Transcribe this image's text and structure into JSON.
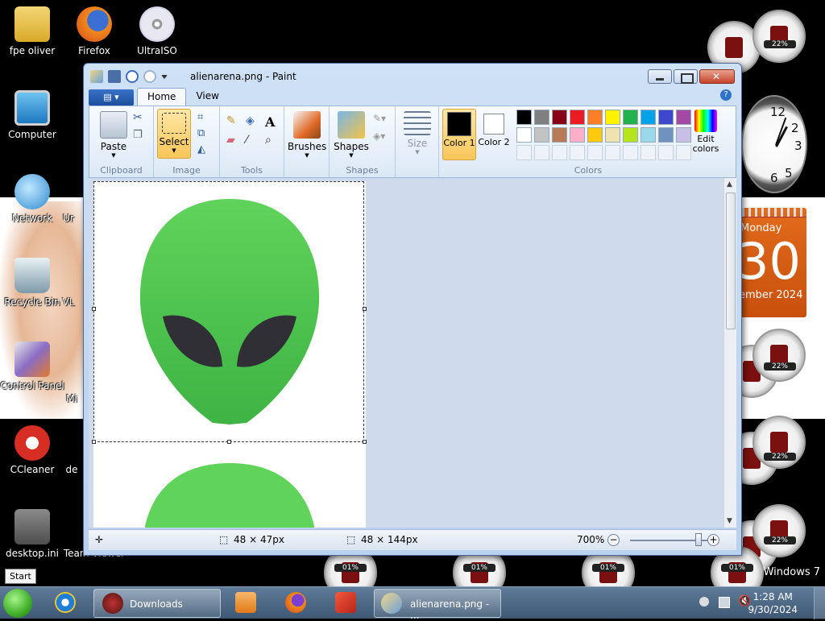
{
  "desktop": {
    "icons": [
      {
        "label": "fpe oliver"
      },
      {
        "label": "Firefox"
      },
      {
        "label": "UltraISO"
      },
      {
        "label": "Computer"
      },
      {
        "label": "Network"
      },
      {
        "label": "Recycle Bin"
      },
      {
        "label": "Control Panel"
      },
      {
        "label": "CCleaner"
      },
      {
        "label": "desktop.ini"
      },
      {
        "label": "Team Viewer"
      }
    ],
    "partial_labels": [
      "Ur",
      "VL",
      "de",
      "Mi"
    ],
    "start_tooltip": "Start",
    "os_watermark": "Windows 7"
  },
  "gadgets": {
    "gauge_percent_labels": [
      "22%",
      "22%",
      "22%",
      "22%",
      "01%",
      "01%",
      "01%",
      "01%"
    ],
    "clock_numbers": [
      "12",
      "2",
      "3",
      "5",
      "6"
    ],
    "calendar": {
      "day": "Monday",
      "date": "30",
      "month": "ember 2024"
    }
  },
  "paint": {
    "title": "alienarena.png - Paint",
    "file_menu_icon": "menu-icon",
    "tabs": [
      {
        "label": "Home",
        "active": true
      },
      {
        "label": "View",
        "active": false
      }
    ],
    "groups": {
      "clipboard": "Clipboard",
      "image": "Image",
      "tools": "Tools",
      "shapes": "Shapes",
      "colors": "Colors"
    },
    "buttons": {
      "paste": "Paste",
      "select": "Select",
      "brushes": "Brushes",
      "shapes": "Shapes",
      "size": "Size",
      "color1": "Color 1",
      "color2": "Color 2",
      "edit_colors": "Edit colors"
    },
    "palette_row1": [
      "#000000",
      "#7f7f7f",
      "#880015",
      "#ed1c24",
      "#ff7f27",
      "#fff200",
      "#22b14c",
      "#00a2e8",
      "#3f48cc",
      "#a349a4"
    ],
    "palette_row2": [
      "#ffffff",
      "#c3c3c3",
      "#b97a57",
      "#ffaec9",
      "#ffc90e",
      "#efe4b0",
      "#b5e61d",
      "#99d9ea",
      "#7092be",
      "#c8bfe7"
    ],
    "color1_value": "#000000",
    "color2_value": "#ffffff",
    "status": {
      "selection_size": "48 × 47px",
      "image_size": "48 × 144px",
      "zoom": "700%"
    },
    "zoom_level": 0.85
  },
  "taskbar": {
    "downloads_label": "Downloads",
    "paint_label": "alienarena.png - ...",
    "time": "1:28 AM",
    "date": "9/30/2024"
  }
}
